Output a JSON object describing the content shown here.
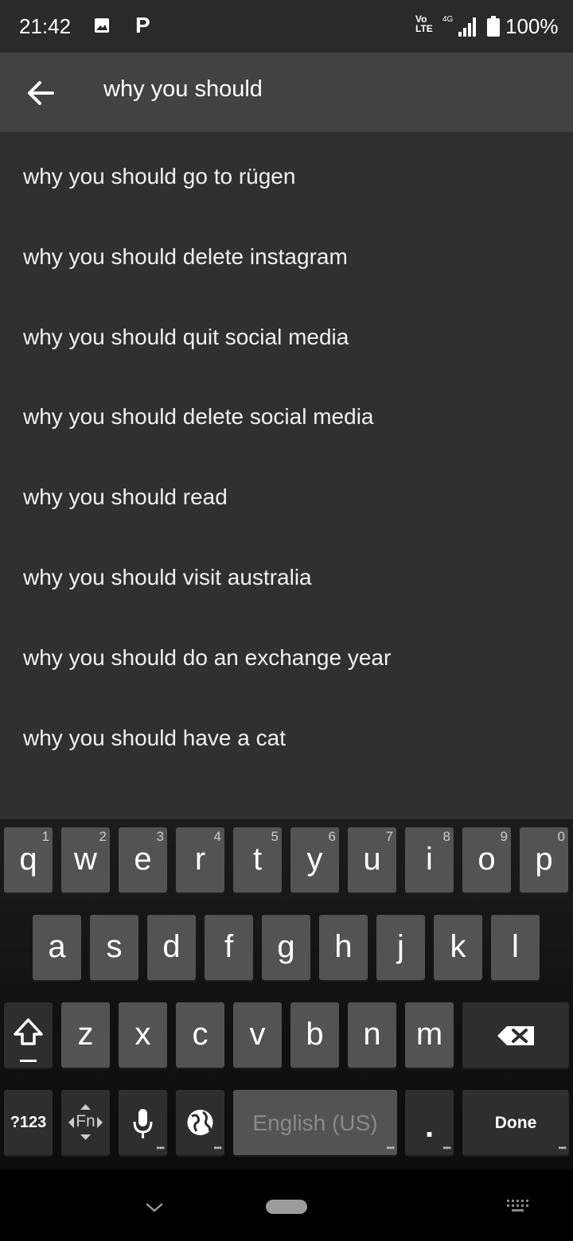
{
  "status_bar": {
    "time": "21:42",
    "notification_icons": [
      "image-icon",
      "parking-icon"
    ],
    "p_glyph": "P",
    "volte_line1": "Vo",
    "volte_line2": "LTE",
    "network": "4G",
    "battery_percent": "100%"
  },
  "search": {
    "query": "why you should"
  },
  "suggestions": [
    "why you should go to rügen",
    "why you should delete instagram",
    "why you should quit social media",
    "why you should delete social media",
    "why you should read",
    "why you should visit australia",
    "why you should do an exchange year",
    "why you should have a cat"
  ],
  "keyboard": {
    "row1": [
      {
        "label": "q",
        "hint": "1"
      },
      {
        "label": "w",
        "hint": "2"
      },
      {
        "label": "e",
        "hint": "3"
      },
      {
        "label": "r",
        "hint": "4"
      },
      {
        "label": "t",
        "hint": "5"
      },
      {
        "label": "y",
        "hint": "6"
      },
      {
        "label": "u",
        "hint": "7"
      },
      {
        "label": "i",
        "hint": "8"
      },
      {
        "label": "o",
        "hint": "9"
      },
      {
        "label": "p",
        "hint": "0"
      }
    ],
    "row2": [
      "a",
      "s",
      "d",
      "f",
      "g",
      "h",
      "j",
      "k",
      "l"
    ],
    "row3": [
      "z",
      "x",
      "c",
      "v",
      "b",
      "n",
      "m"
    ],
    "symbols_label": "?123",
    "fn_label": "Fn",
    "space_label": "English (US)",
    "period_label": ".",
    "done_label": "Done"
  },
  "colors": {
    "status_bg": "#2a2a2a",
    "search_bg": "#424242",
    "list_bg": "#303030",
    "key_bg": "#535353",
    "key_dark_bg": "#2e2e2e"
  }
}
